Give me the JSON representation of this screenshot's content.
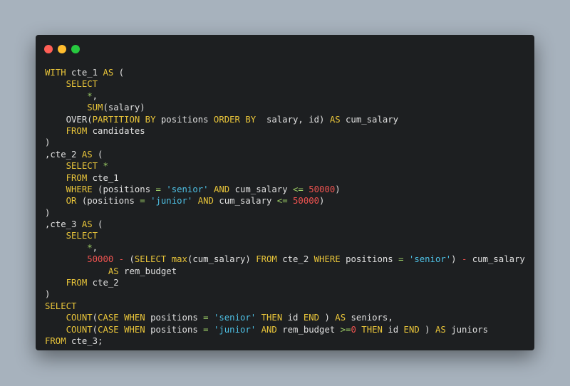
{
  "window": {
    "buttons": {
      "close": "#ff5f56",
      "minimize": "#ffbd2e",
      "zoom": "#27c93f"
    },
    "background": "#1d1f21"
  },
  "colors": {
    "keyword": "#e9c53a",
    "string": "#4ec0e4",
    "number": "#ef5350",
    "operator": "#9ccc65",
    "text": "#e0e0e0",
    "page_background": "#a7b2bd"
  },
  "code": {
    "lines": [
      [
        [
          "kw",
          "WITH"
        ],
        [
          "tx",
          " cte_1 "
        ],
        [
          "kw",
          "AS"
        ],
        [
          "tx",
          " ("
        ]
      ],
      [
        [
          "tx",
          "    "
        ],
        [
          "kw",
          "SELECT"
        ]
      ],
      [
        [
          "tx",
          "        "
        ],
        [
          "op",
          "*"
        ],
        [
          "tx",
          ","
        ]
      ],
      [
        [
          "tx",
          "        "
        ],
        [
          "kw",
          "SUM"
        ],
        [
          "tx",
          "(salary)"
        ]
      ],
      [
        [
          "tx",
          "    OVER("
        ],
        [
          "kw",
          "PARTITION BY"
        ],
        [
          "tx",
          " positions "
        ],
        [
          "kw",
          "ORDER BY"
        ],
        [
          "tx",
          "  salary, id) "
        ],
        [
          "kw",
          "AS"
        ],
        [
          "tx",
          " cum_salary"
        ]
      ],
      [
        [
          "tx",
          "    "
        ],
        [
          "kw",
          "FROM"
        ],
        [
          "tx",
          " candidates"
        ]
      ],
      [
        [
          "tx",
          ")"
        ]
      ],
      [
        [
          "tx",
          ",cte_2 "
        ],
        [
          "kw",
          "AS"
        ],
        [
          "tx",
          " ("
        ]
      ],
      [
        [
          "tx",
          "    "
        ],
        [
          "kw",
          "SELECT"
        ],
        [
          "tx",
          " "
        ],
        [
          "op",
          "*"
        ]
      ],
      [
        [
          "tx",
          "    "
        ],
        [
          "kw",
          "FROM"
        ],
        [
          "tx",
          " cte_1"
        ]
      ],
      [
        [
          "tx",
          "    "
        ],
        [
          "kw",
          "WHERE"
        ],
        [
          "tx",
          " (positions "
        ],
        [
          "op",
          "="
        ],
        [
          "tx",
          " "
        ],
        [
          "str",
          "'senior'"
        ],
        [
          "tx",
          " "
        ],
        [
          "kw",
          "AND"
        ],
        [
          "tx",
          " cum_salary "
        ],
        [
          "op",
          "<="
        ],
        [
          "tx",
          " "
        ],
        [
          "num",
          "50000"
        ],
        [
          "tx",
          ")"
        ]
      ],
      [
        [
          "tx",
          "    "
        ],
        [
          "kw",
          "OR"
        ],
        [
          "tx",
          " (positions "
        ],
        [
          "op",
          "="
        ],
        [
          "tx",
          " "
        ],
        [
          "str",
          "'junior'"
        ],
        [
          "tx",
          " "
        ],
        [
          "kw",
          "AND"
        ],
        [
          "tx",
          " cum_salary "
        ],
        [
          "op",
          "<="
        ],
        [
          "tx",
          " "
        ],
        [
          "num",
          "50000"
        ],
        [
          "tx",
          ")"
        ]
      ],
      [
        [
          "tx",
          ")"
        ]
      ],
      [
        [
          "tx",
          ",cte_3 "
        ],
        [
          "kw",
          "AS"
        ],
        [
          "tx",
          " ("
        ]
      ],
      [
        [
          "tx",
          "    "
        ],
        [
          "kw",
          "SELECT"
        ]
      ],
      [
        [
          "tx",
          "        "
        ],
        [
          "op",
          "*"
        ],
        [
          "tx",
          ","
        ]
      ],
      [
        [
          "tx",
          "        "
        ],
        [
          "num",
          "50000"
        ],
        [
          "tx",
          " "
        ],
        [
          "op2",
          "-"
        ],
        [
          "tx",
          " ("
        ],
        [
          "kw",
          "SELECT"
        ],
        [
          "tx",
          " "
        ],
        [
          "kw",
          "max"
        ],
        [
          "tx",
          "(cum_salary) "
        ],
        [
          "kw",
          "FROM"
        ],
        [
          "tx",
          " cte_2 "
        ],
        [
          "kw",
          "WHERE"
        ],
        [
          "tx",
          " positions "
        ],
        [
          "op",
          "="
        ],
        [
          "tx",
          " "
        ],
        [
          "str",
          "'senior'"
        ],
        [
          "tx",
          ") "
        ],
        [
          "op2",
          "-"
        ],
        [
          "tx",
          " cum_salary"
        ]
      ],
      [
        [
          "tx",
          "            "
        ],
        [
          "kw",
          "AS"
        ],
        [
          "tx",
          " rem_budget"
        ]
      ],
      [
        [
          "tx",
          "    "
        ],
        [
          "kw",
          "FROM"
        ],
        [
          "tx",
          " cte_2"
        ]
      ],
      [
        [
          "tx",
          ")"
        ]
      ],
      [
        [
          "kw",
          "SELECT"
        ]
      ],
      [
        [
          "tx",
          "    "
        ],
        [
          "kw",
          "COUNT"
        ],
        [
          "tx",
          "("
        ],
        [
          "kw",
          "CASE"
        ],
        [
          "tx",
          " "
        ],
        [
          "kw",
          "WHEN"
        ],
        [
          "tx",
          " positions "
        ],
        [
          "op",
          "="
        ],
        [
          "tx",
          " "
        ],
        [
          "str",
          "'senior'"
        ],
        [
          "tx",
          " "
        ],
        [
          "kw",
          "THEN"
        ],
        [
          "tx",
          " id "
        ],
        [
          "kw",
          "END"
        ],
        [
          "tx",
          " ) "
        ],
        [
          "kw",
          "AS"
        ],
        [
          "tx",
          " seniors,"
        ]
      ],
      [
        [
          "tx",
          "    "
        ],
        [
          "kw",
          "COUNT"
        ],
        [
          "tx",
          "("
        ],
        [
          "kw",
          "CASE"
        ],
        [
          "tx",
          " "
        ],
        [
          "kw",
          "WHEN"
        ],
        [
          "tx",
          " positions "
        ],
        [
          "op",
          "="
        ],
        [
          "tx",
          " "
        ],
        [
          "str",
          "'junior'"
        ],
        [
          "tx",
          " "
        ],
        [
          "kw",
          "AND"
        ],
        [
          "tx",
          " rem_budget "
        ],
        [
          "op",
          ">="
        ],
        [
          "num",
          "0"
        ],
        [
          "tx",
          " "
        ],
        [
          "kw",
          "THEN"
        ],
        [
          "tx",
          " id "
        ],
        [
          "kw",
          "END"
        ],
        [
          "tx",
          " ) "
        ],
        [
          "kw",
          "AS"
        ],
        [
          "tx",
          " juniors"
        ]
      ],
      [
        [
          "kw",
          "FROM"
        ],
        [
          "tx",
          " cte_3;"
        ]
      ]
    ]
  }
}
